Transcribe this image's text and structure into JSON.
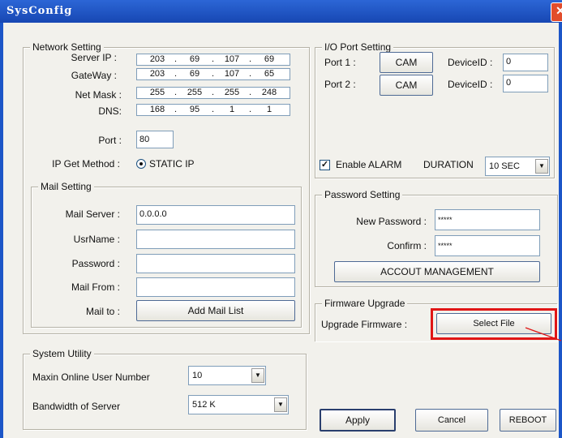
{
  "window": {
    "title": "SysConfig",
    "close_glyph": "✕"
  },
  "network": {
    "legend": "Network Setting",
    "server_ip_label": "Server IP :",
    "server_ip": [
      "203",
      "69",
      "107",
      "69"
    ],
    "gateway_label": "GateWay :",
    "gateway": [
      "203",
      "69",
      "107",
      "65"
    ],
    "netmask_label": "Net Mask :",
    "netmask": [
      "255",
      "255",
      "255",
      "248"
    ],
    "dns_label": "DNS:",
    "dns": [
      "168",
      "95",
      "1",
      "1"
    ],
    "port_label": "Port :",
    "port_value": "80",
    "ip_method_label": "IP Get Method :",
    "ip_method_value": "STATIC IP"
  },
  "mail": {
    "legend": "Mail Setting",
    "server_label": "Mail Server :",
    "server_value": "0.0.0.0",
    "username_label": "UsrName :",
    "username_value": "",
    "password_label": "Password :",
    "password_value": "",
    "from_label": "Mail From :",
    "from_value": "",
    "to_label": "Mail to :",
    "add_button": "Add Mail List"
  },
  "system": {
    "legend": "System Utility",
    "max_users_label": "Maxin Online User Number",
    "max_users_value": "10",
    "bandwidth_label": "Bandwidth of Server",
    "bandwidth_value": "512 K"
  },
  "io": {
    "legend": "I/O Port Setting",
    "port1_label": "Port 1 :",
    "port1_button": "CAM",
    "port1_device_label": "DeviceID :",
    "port1_device_value": "0",
    "port2_label": "Port 2 :",
    "port2_button": "CAM",
    "port2_device_label": "DeviceID :",
    "port2_device_value": "0"
  },
  "alarm": {
    "checked_glyph": "✓",
    "label": "Enable ALARM",
    "duration_label": "DURATION",
    "duration_value": "10 SEC"
  },
  "password": {
    "legend": "Password Setting",
    "new_label": "New Password :",
    "new_value": "*****",
    "confirm_label": "Confirm :",
    "confirm_value": "*****",
    "manage_button": "ACCOUT MANAGEMENT"
  },
  "firmware": {
    "legend": "Firmware Upgrade",
    "label": "Upgrade Firmware :",
    "select_button": "Select File"
  },
  "footer": {
    "apply": "Apply",
    "cancel": "Cancel",
    "reboot": "REBOOT"
  },
  "colors": {
    "highlight": "#e01616",
    "titlebar": "#1c56c8"
  }
}
